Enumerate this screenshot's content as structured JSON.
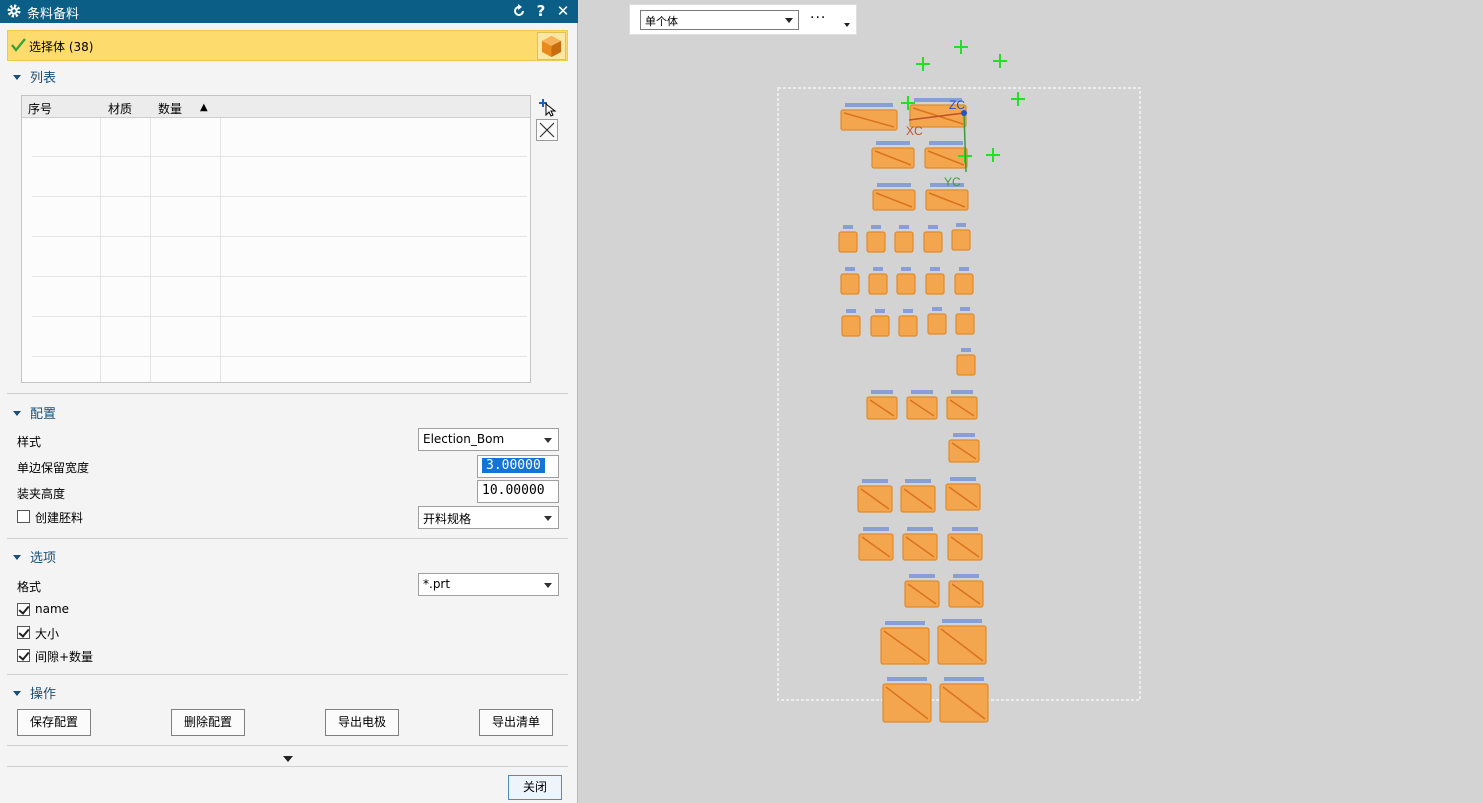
{
  "dialog": {
    "title": "条料备料",
    "reset_icon": "reset-icon",
    "help_label": "?",
    "close_label": "✕",
    "selection": {
      "label": "选择体 (38)"
    },
    "list_section": {
      "title": "列表",
      "columns": [
        "序号",
        "材质",
        "数量"
      ],
      "sort_indicator": "▲"
    },
    "config_section": {
      "title": "配置",
      "style_label": "样式",
      "style_value": "Election_Bom",
      "margin_label": "单边保留宽度",
      "margin_value": "3.00000",
      "clamp_label": "装夹高度",
      "clamp_value": "10.00000",
      "create_blank_label": "创建胚料",
      "create_blank_checked": false,
      "spec_value": "开料规格"
    },
    "options_section": {
      "title": "选项",
      "format_label": "格式",
      "format_value": "*.prt",
      "checks": [
        {
          "label": "name",
          "checked": true
        },
        {
          "label": "大小",
          "checked": true
        },
        {
          "label": "间隙+数量",
          "checked": true
        }
      ]
    },
    "actions_section": {
      "title": "操作",
      "save_config": "保存配置",
      "delete_config": "删除配置",
      "export_electrode": "导出电极",
      "export_list": "导出清单"
    },
    "close_button": "关闭"
  },
  "viewport": {
    "selection_filter": "单个体",
    "more_label": "···",
    "axis_labels": {
      "x": "XC",
      "y": "YC",
      "z": "ZC"
    },
    "colors": {
      "body": "#f4a64e",
      "marker": "#22e022",
      "axis_x": "#c0502a",
      "axis_y": "#3e9a3e",
      "axis_z": "#2255cc"
    }
  }
}
